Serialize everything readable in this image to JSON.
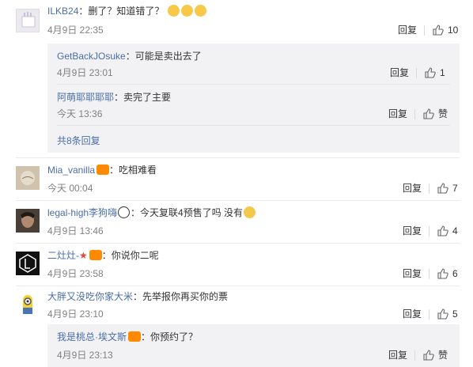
{
  "comments": [
    {
      "user": "ILKB24",
      "text": "：删了？知道错了？",
      "time": "4月9日 22:35",
      "reply": "回复",
      "likes": "10",
      "subs": [
        {
          "user": "GetBackJOsuke",
          "text": "：可能是卖出去了",
          "time": "4月9日 23:01",
          "reply": "回复",
          "likes": "1"
        },
        {
          "user": "阿萌耶耶耶耶",
          "text": "：卖完了主要",
          "time": "今天 13:36",
          "reply": "回复",
          "likes": "赞"
        }
      ],
      "more": "共8条回复"
    },
    {
      "user": "Mia_vanilla",
      "text": "：吃相难看",
      "time": "今天 00:04",
      "reply": "回复",
      "likes": "7"
    },
    {
      "user": "legal-high李狗嗨",
      "text": "：今天复联4预售了吗 没有",
      "time": "4月9日 13:46",
      "reply": "回复",
      "likes": "4"
    },
    {
      "user": "二灶灶-",
      "text": "：你说你二呢",
      "time": "4月9日 23:58",
      "reply": "回复",
      "likes": "6"
    },
    {
      "user": "大胖又没吃你家大米",
      "text": "：先举报你再买你的票",
      "time": "4月9日 23:10",
      "reply": "回复",
      "likes": "5",
      "subs": [
        {
          "user": "我是桃总·埃文斯",
          "text": "：你预约了？",
          "time": "4月9日 23:13",
          "reply": "回复",
          "likes": "赞"
        }
      ]
    }
  ],
  "colors": {
    "username": "#eb7350",
    "link": "#4a6ea9",
    "meta": "#808080",
    "subbox": "#f2f2f5"
  }
}
